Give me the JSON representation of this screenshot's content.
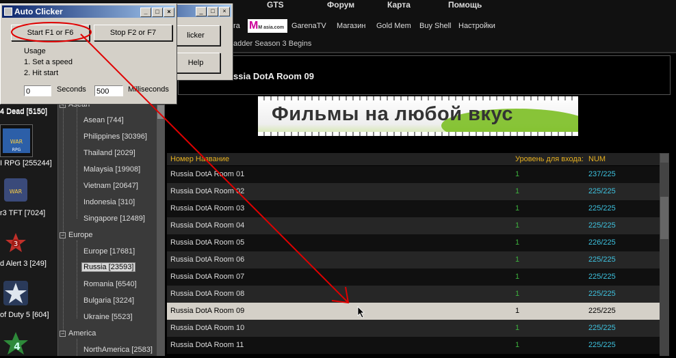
{
  "nav": {
    "row1": [
      "GTS",
      "Форум",
      "Карта",
      "Помощь"
    ],
    "row2": [
      "ra",
      "GarenaTV",
      "Магазин",
      "Gold Mem",
      "Buy Shell",
      "Настройки"
    ],
    "mtv_logo": "M asia.com",
    "ladder": "adder Season 3 Begins"
  },
  "room_title": "ssia DotA Room 09",
  "banner_text": "Фильмы на любой вкус",
  "games": [
    {
      "label": "4 Dead [5150]",
      "icon": "game-icon-4dead"
    },
    {
      "label": "I RPG [255244]",
      "icon": "warcraft-rpg-icon"
    },
    {
      "label": "r3 TFT [7024]",
      "icon": "warcraft-tft-icon"
    },
    {
      "label": "d Alert 3 [249]",
      "icon": "red-alert-3-icon"
    },
    {
      "label": "of Duty 5 [604]",
      "icon": "call-of-duty-5-icon"
    },
    {
      "label": "",
      "icon": "game-icon-4"
    }
  ],
  "tree": {
    "asia_group": "Asean",
    "asia": [
      "Asean [744]",
      "Philippines [30396]",
      "Thailand [2029]",
      "Malaysia [19908]",
      "Vietnam [20647]",
      "Indonesia [310]",
      "Singapore [12489]"
    ],
    "europe_group": "Europe",
    "europe": [
      "Europe [17681]",
      "Russia [23593]",
      "Romania [6540]",
      "Bulgaria [3224]",
      "Ukraine [5523]"
    ],
    "america_group": "America",
    "america": [
      "NorthAmerica [2583]"
    ],
    "selected": "Russia [23593]"
  },
  "table": {
    "headers": {
      "name": "Номер Название",
      "level": "Уровень для входа:",
      "num": "NUM"
    },
    "rows": [
      {
        "name": "Russia DotA Room 01",
        "level": "1",
        "num": "237/225"
      },
      {
        "name": "Russia DotA Room 02",
        "level": "1",
        "num": "225/225"
      },
      {
        "name": "Russia DotA Room 03",
        "level": "1",
        "num": "225/225"
      },
      {
        "name": "Russia DotA Room 04",
        "level": "1",
        "num": "225/225"
      },
      {
        "name": "Russia DotA Room 05",
        "level": "1",
        "num": "226/225"
      },
      {
        "name": "Russia DotA Room 06",
        "level": "1",
        "num": "225/225"
      },
      {
        "name": "Russia DotA Room 07",
        "level": "1",
        "num": "225/225"
      },
      {
        "name": "Russia DotA Room 08",
        "level": "1",
        "num": "225/225"
      },
      {
        "name": "Russia DotA Room 09",
        "level": "1",
        "num": "225/225"
      },
      {
        "name": "Russia DotA Room 10",
        "level": "1",
        "num": "225/225"
      },
      {
        "name": "Russia DotA Room 11",
        "level": "1",
        "num": "225/225"
      }
    ],
    "selected_index": 8
  },
  "autoclicker": {
    "title": "Auto Clicker",
    "start_label": "Start F1 or F6",
    "stop_label": "Stop F2 or F7",
    "usage_title": "Usage",
    "step1": "1. Set a speed",
    "step2": "2. Hit start",
    "seconds_value": "0",
    "seconds_label": "Seconds",
    "ms_value": "500",
    "ms_label": "Milliseconds",
    "title_buttons": [
      "_",
      "□",
      "×"
    ]
  },
  "autoclicker2": {
    "clicker_label": "licker",
    "help_label": "Help"
  },
  "colors": {
    "header_text": "#e6b020",
    "level_text": "#3db33d",
    "num_text": "#3ec3e0",
    "annotation": "#e00000"
  }
}
